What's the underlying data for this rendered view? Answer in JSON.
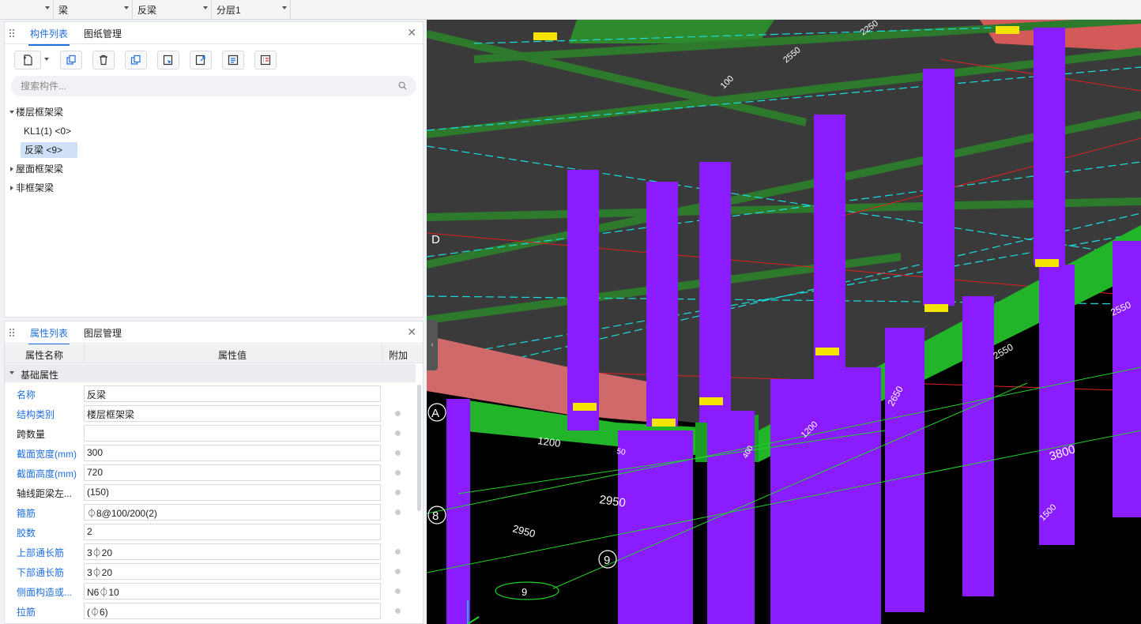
{
  "topbar": {
    "floor_value": "",
    "type_value": "梁",
    "component_value": "反梁",
    "layer_value": "分层1"
  },
  "component_panel": {
    "tabs": [
      "构件列表",
      "图纸管理"
    ],
    "search_placeholder": "搜索构件...",
    "toolbar_icons": [
      "new-icon",
      "copy-icon",
      "delete-icon",
      "layer-copy-icon",
      "pick-icon",
      "export-icon",
      "align-icon",
      "list-icon"
    ],
    "tree": {
      "group1": "楼层框架梁",
      "item1": "KL1(1)  <0>",
      "item2": "反梁  <9>",
      "group2": "屋面框架梁",
      "group3": "非框架梁"
    }
  },
  "property_panel": {
    "tabs": [
      "属性列表",
      "图层管理"
    ],
    "headers": [
      "属性名称",
      "属性值",
      "附加"
    ],
    "group": "基础属性",
    "rows": [
      {
        "name": "名称",
        "value": "反梁"
      },
      {
        "name": "结构类别",
        "value": "楼层框架梁"
      },
      {
        "name": "跨数量",
        "value": ""
      },
      {
        "name": "截面宽度(mm)",
        "value": "300"
      },
      {
        "name": "截面高度(mm)",
        "value": "720"
      },
      {
        "name": "轴线距梁左...",
        "value": "(150)"
      },
      {
        "name": "箍筋",
        "value": "⏀8@100/200(2)"
      },
      {
        "name": "胶数",
        "value": "2"
      },
      {
        "name": "上部通长筋",
        "value": "3⏀20"
      },
      {
        "name": "下部通长筋",
        "value": "3⏀20"
      },
      {
        "name": "侧面构造或...",
        "value": "N6⏀10"
      },
      {
        "name": "拉筋",
        "value": "(⏀6)"
      }
    ]
  },
  "viewport": {
    "axis_labels": [
      "A",
      "D",
      "8",
      "9",
      "9"
    ],
    "dimensions": [
      "2950",
      "2950",
      "1200",
      "3800",
      "2650",
      "2550",
      "2550",
      "1500",
      "1200",
      "400",
      "50",
      "100",
      "2250",
      "2550"
    ],
    "colors": {
      "background": "#383838",
      "column": "#8a1cff",
      "beam": "#22b52a",
      "grid_line": "#19e0e0",
      "red_line": "#e02020",
      "yellow_mark": "#f5e400",
      "slab": "#2d8a2d"
    }
  }
}
